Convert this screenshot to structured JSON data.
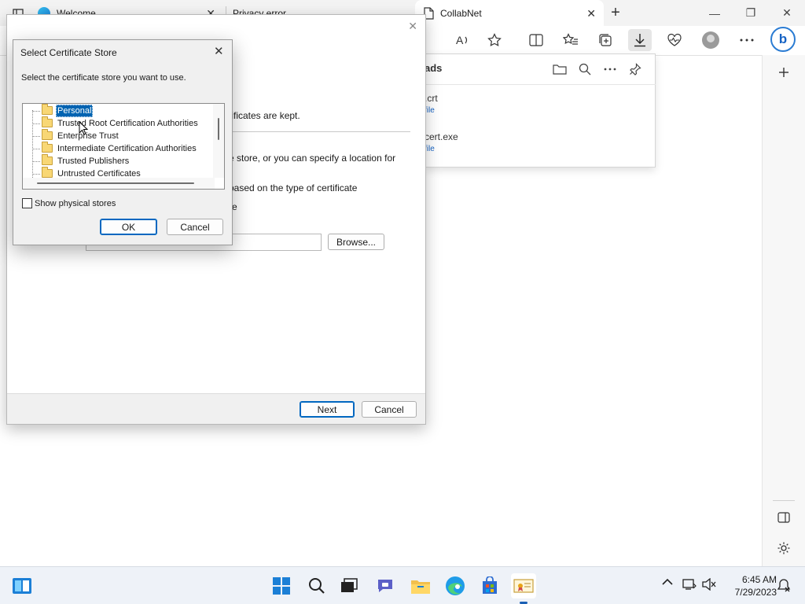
{
  "browser": {
    "tabs": [
      {
        "label": "Welcome"
      },
      {
        "label": "Privacy error"
      },
      {
        "label": "CollabNet"
      }
    ],
    "new_tab_symbol": "+",
    "toolbar_icons": [
      "read-aloud-icon",
      "favorite-star-icon",
      "split-screen-icon",
      "favorites-icon",
      "collections-icon",
      "downloads-icon",
      "health-icon",
      "profile-icon",
      "more-icon"
    ],
    "sidebar_icons": [
      "add-icon",
      "sidebar-toggle-icon",
      "settings-icon"
    ]
  },
  "downloads": {
    "title": "ads",
    "items": [
      {
        "name": ".crt",
        "link": "file"
      },
      {
        "name": "cert.exe",
        "link": "file"
      }
    ]
  },
  "wizard": {
    "line1": "tificates are kept.",
    "line2": "e store, or you can specify a location for",
    "line3": "based on the type of certificate",
    "line4": "re",
    "browse_label": "Browse...",
    "next_label": "Next",
    "cancel_label": "Cancel"
  },
  "dialog": {
    "title": "Select Certificate Store",
    "prompt": "Select the certificate store you want to use.",
    "stores": [
      {
        "label": "Personal",
        "selected": true
      },
      {
        "label": "Trusted Root Certification Authorities",
        "selected": false
      },
      {
        "label": "Enterprise Trust",
        "selected": false
      },
      {
        "label": "Intermediate Certification Authorities",
        "selected": false
      },
      {
        "label": "Trusted Publishers",
        "selected": false
      },
      {
        "label": "Untrusted Certificates",
        "selected": false
      }
    ],
    "show_physical_label": "Show physical stores",
    "show_physical_checked": false,
    "ok_label": "OK",
    "cancel_label": "Cancel"
  },
  "taskbar": {
    "time": "6:45 AM",
    "date": "7/29/2023",
    "apps": [
      "start-icon",
      "search-icon",
      "task-view-icon",
      "teams-chat-icon",
      "file-explorer-icon",
      "edge-icon",
      "store-icon",
      "certificate-manager-icon"
    ]
  }
}
